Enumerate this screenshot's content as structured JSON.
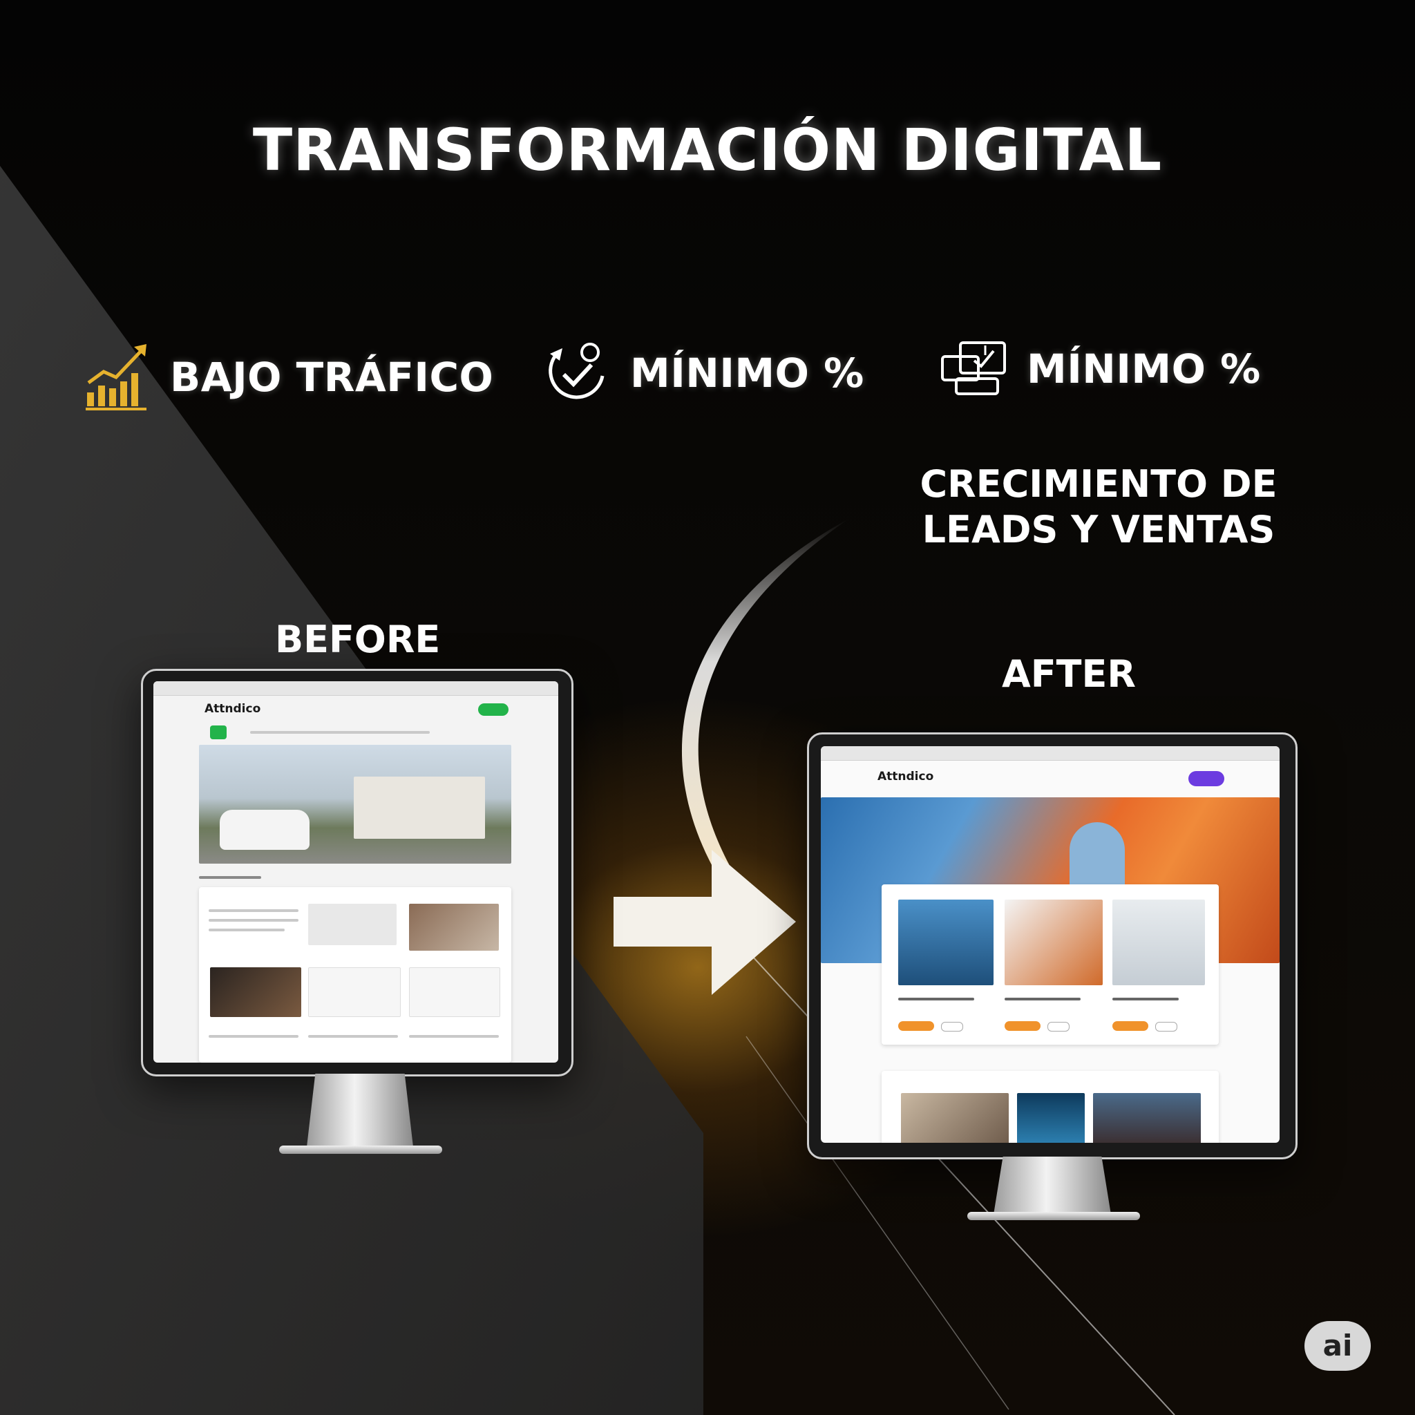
{
  "heading": "TRANSFORMACIÓN DIGITAL",
  "metrics": [
    {
      "label": "BAJO TRÁFICO",
      "icon": "rising-bar-chart-icon",
      "color": "#e6b22e"
    },
    {
      "label": "MÍNIMO %",
      "icon": "circular-check-icon",
      "color": "#ffffff"
    },
    {
      "label": "MÍNIMO %",
      "icon": "screen-analytics-icon",
      "color": "#ffffff"
    }
  ],
  "growth_text": {
    "line1": "CRECIMIENTO DE",
    "line2": "LEADS Y VENTAS"
  },
  "before_label": "BEFORE",
  "after_label": "AFTER",
  "before_site": {
    "logo": "Attndico",
    "accent": "#22b34a"
  },
  "after_site": {
    "logo": "Attndico",
    "accent": "#6c3ce0",
    "cta": "#f0922b"
  },
  "badge": "ai"
}
